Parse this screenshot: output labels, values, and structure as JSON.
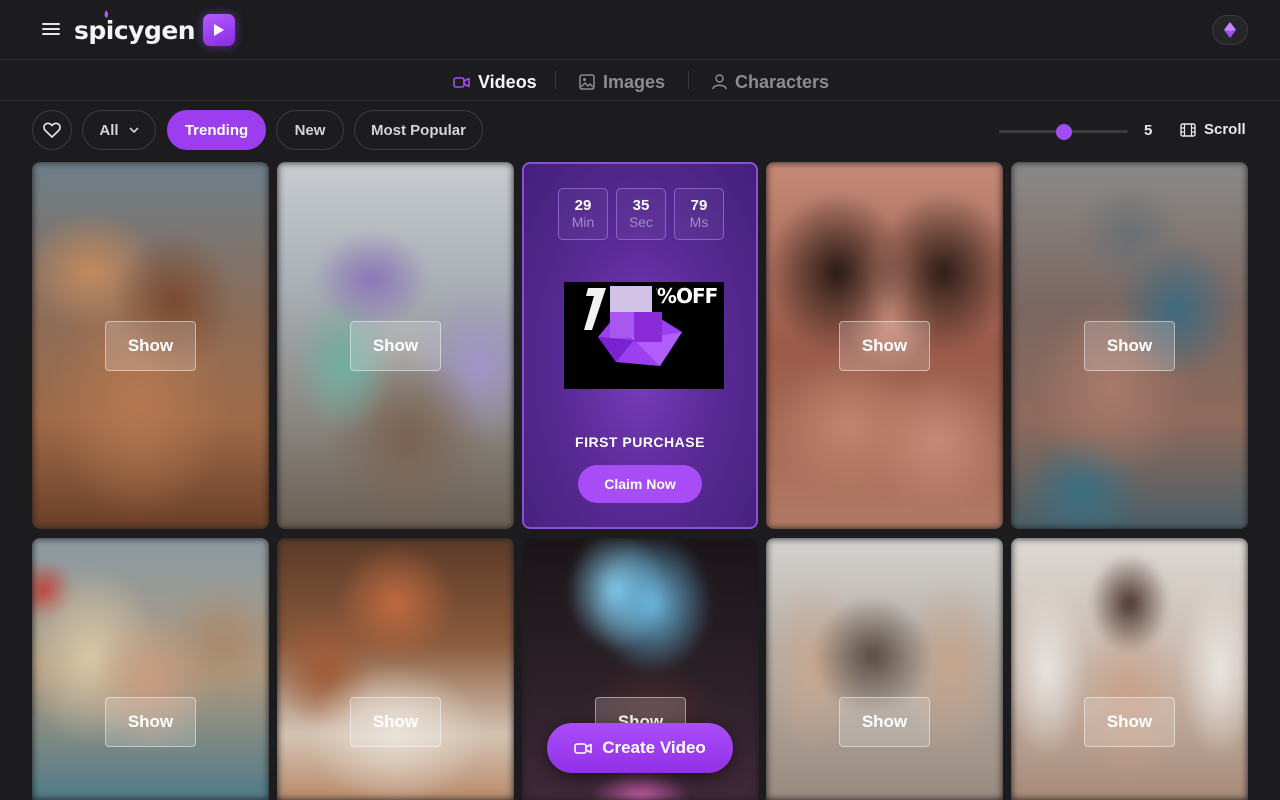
{
  "app": {
    "brand": "spicygen"
  },
  "header": {
    "menu_icon": "hamburger-icon",
    "gem_icon": "diamond-icon"
  },
  "tabs": [
    {
      "label": "Videos",
      "icon": "video-camera-icon",
      "active": true
    },
    {
      "label": "Images",
      "icon": "image-icon",
      "active": false
    },
    {
      "label": "Characters",
      "icon": "person-icon",
      "active": false
    }
  ],
  "filters": {
    "favorites_icon": "heart-icon",
    "all_label": "All",
    "trending_label": "Trending",
    "new_label": "New",
    "popular_label": "Most Popular",
    "active": "Trending"
  },
  "columns_slider": {
    "value": "5",
    "fraction": 0.5
  },
  "scroll_label": "Scroll",
  "show_label": "Show",
  "promo": {
    "timer": [
      {
        "value": "29",
        "unit": "Min"
      },
      {
        "value": "35",
        "unit": "Sec"
      },
      {
        "value": "79",
        "unit": "Ms"
      }
    ],
    "discount_text": "7%OFF",
    "label": "FIRST PURCHASE",
    "button": "Claim Now"
  },
  "create_button": "Create Video",
  "colors": {
    "accent": "#9d3df0",
    "background": "#1c1c1e"
  }
}
